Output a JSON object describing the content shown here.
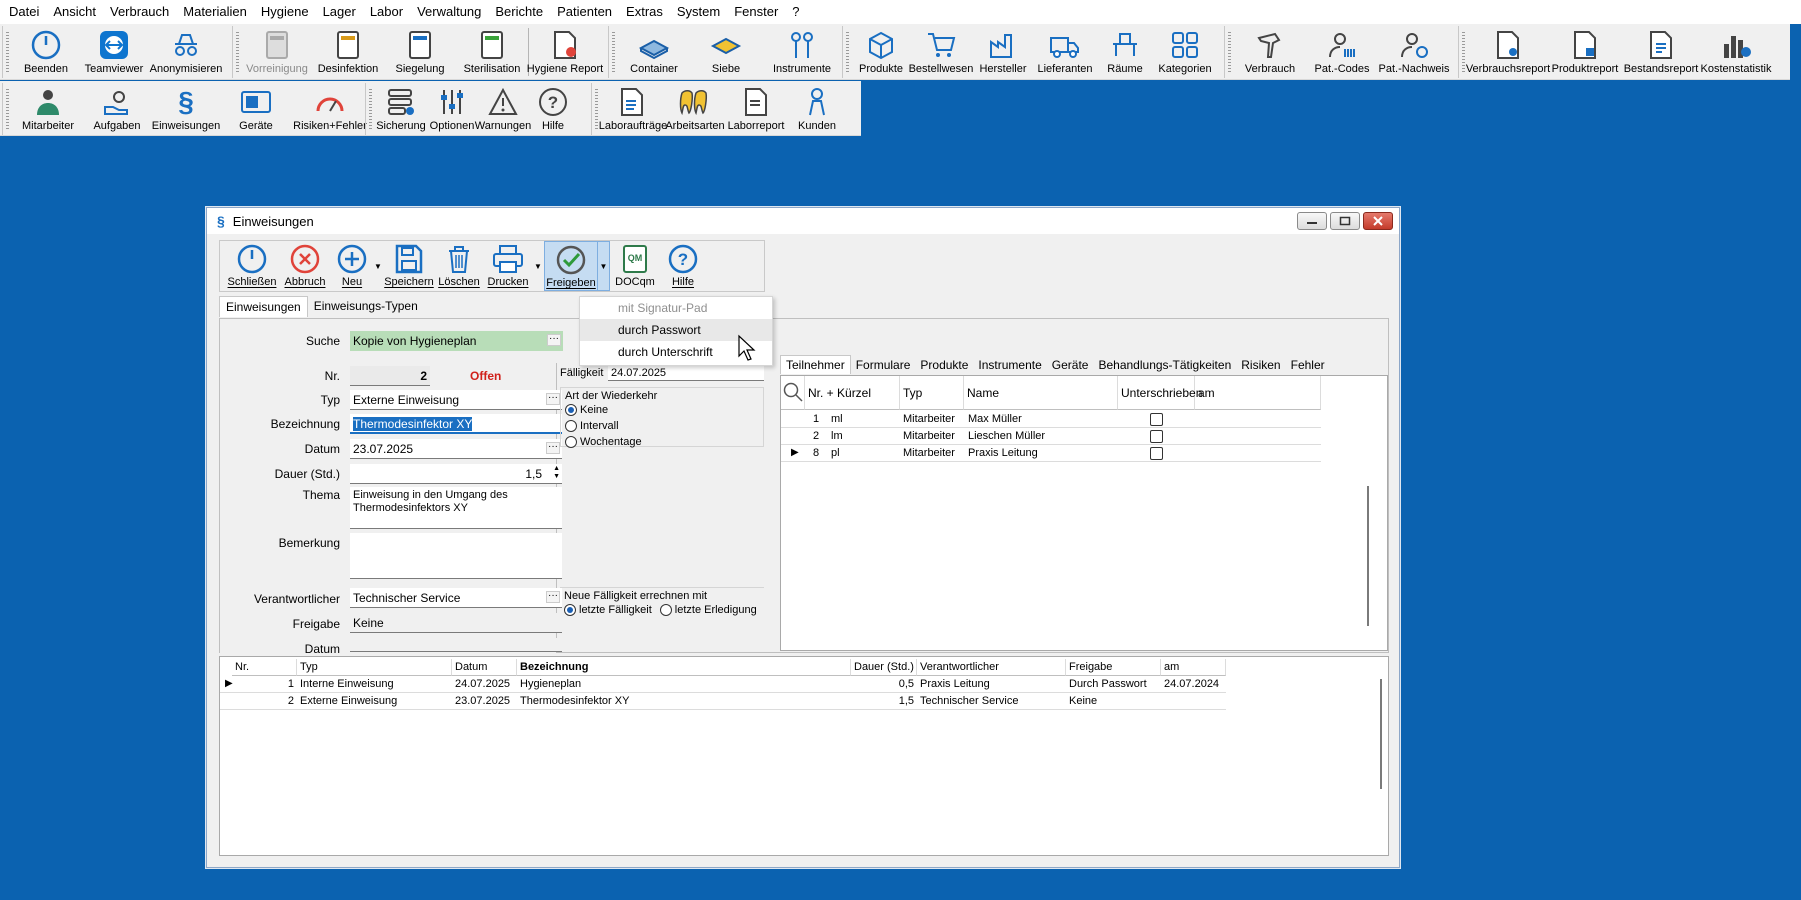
{
  "menu": [
    "Datei",
    "Ansicht",
    "Verbrauch",
    "Materialien",
    "Hygiene",
    "Lager",
    "Labor",
    "Verwaltung",
    "Berichte",
    "Patienten",
    "Extras",
    "System",
    "Fenster",
    "?"
  ],
  "toolbar1": {
    "g1": [
      "Beenden",
      "Teamviewer",
      "Anonymisieren"
    ],
    "g2": [
      "Vorreinigung",
      "Desinfektion",
      "Siegelung",
      "Sterilisation",
      "Hygiene Report"
    ],
    "g3": [
      "Container",
      "Siebe",
      "Instrumente"
    ],
    "g4": [
      "Produkte",
      "Bestellwesen",
      "Hersteller",
      "Lieferanten",
      "Räume",
      "Kategorien"
    ],
    "g5": [
      "Verbrauch",
      "Pat.-Codes",
      "Pat.-Nachweis"
    ],
    "g6": [
      "Verbrauchsreport",
      "Produktreport",
      "Bestandsreport",
      "Kostenstatistik"
    ]
  },
  "toolbar2": {
    "g1": [
      "Mitarbeiter",
      "Aufgaben",
      "Einweisungen",
      "Geräte",
      "Risiken+Fehler"
    ],
    "g2": [
      "Sicherung",
      "Optionen",
      "Warnungen",
      "Hilfe"
    ],
    "g3": [
      "Laboraufträge",
      "Arbeitsarten",
      "Laborreport",
      "Kunden"
    ]
  },
  "window": {
    "title": "Einweisungen",
    "toolbar": [
      "Schließen",
      "Abbruch",
      "Neu",
      "Speichern",
      "Löschen",
      "Drucken",
      "Freigeben",
      "DOCqm",
      "Hilfe"
    ],
    "docqm_badge": "QM",
    "tabs": [
      "Einweisungen",
      "Einweisungs-Typen"
    ],
    "search_label": "Suche",
    "search_value": "Kopie von Hygieneplan",
    "form": {
      "nr_label": "Nr.",
      "nr_value": "2",
      "status": "Offen",
      "typ_label": "Typ",
      "typ_value": "Externe Einweisung",
      "bez_label": "Bezeichnung",
      "bez_value": "Thermodesinfektor XY",
      "datum_label": "Datum",
      "datum_value": "23.07.2025",
      "dauer_label": "Dauer (Std.)",
      "dauer_value": "1,5",
      "thema_label": "Thema",
      "thema_value": "Einweisung in den Umgang des Thermodesinfektors XY",
      "bem_label": "Bemerkung",
      "bem_value": "",
      "verant_label": "Verantwortlicher",
      "verant_value": "Technischer Service",
      "freigabe_label": "Freigabe",
      "freigabe_value": "Keine",
      "datum2_label": "Datum",
      "datum2_value": ""
    },
    "mid": {
      "faellig_label": "Fälligkeit",
      "faellig_value": "24.07.2025",
      "art_label": "Art der Wiederkehr",
      "art_options": [
        "Keine",
        "Intervall",
        "Wochentage"
      ],
      "neue_label": "Neue Fälligkeit errechnen mit",
      "neue_options": [
        "letzte Fälligkeit",
        "letzte Erledigung"
      ]
    },
    "grid_tabs": [
      "Teilnehmer",
      "Formulare",
      "Produkte",
      "Instrumente",
      "Geräte",
      "Behandlungs-Tätigkeiten",
      "Risiken",
      "Fehler"
    ],
    "teilnehmer_headers": [
      "Nr. + Kürzel",
      "Typ",
      "Name",
      "Unterschrieben",
      "am"
    ],
    "teilnehmer": [
      {
        "nr": "1",
        "kuerzel": "ml",
        "typ": "Mitarbeiter",
        "name": "Max Müller"
      },
      {
        "nr": "2",
        "kuerzel": "lm",
        "typ": "Mitarbeiter",
        "name": "Lieschen Müller"
      },
      {
        "nr": "8",
        "kuerzel": "pl",
        "typ": "Mitarbeiter",
        "name": "Praxis Leitung"
      }
    ],
    "bottom_headers": [
      "Nr.",
      "Typ",
      "Datum",
      "Bezeichnung",
      "Dauer (Std.)",
      "Verantwortlicher",
      "Freigabe",
      "am"
    ],
    "bottom_rows": [
      {
        "nr": "1",
        "typ": "Interne Einweisung",
        "datum": "24.07.2025",
        "bez": "Hygieneplan",
        "dauer": "0,5",
        "verant": "Praxis Leitung",
        "freigabe": "Durch Passwort",
        "am": "24.07.2024"
      },
      {
        "nr": "2",
        "typ": "Externe Einweisung",
        "datum": "23.07.2025",
        "bez": "Thermodesinfektor XY",
        "dauer": "1,5",
        "verant": "Technischer Service",
        "freigabe": "Keine",
        "am": ""
      }
    ],
    "dropdown": [
      "mit Signatur-Pad",
      "durch Passwort",
      "durch Unterschrift"
    ]
  }
}
